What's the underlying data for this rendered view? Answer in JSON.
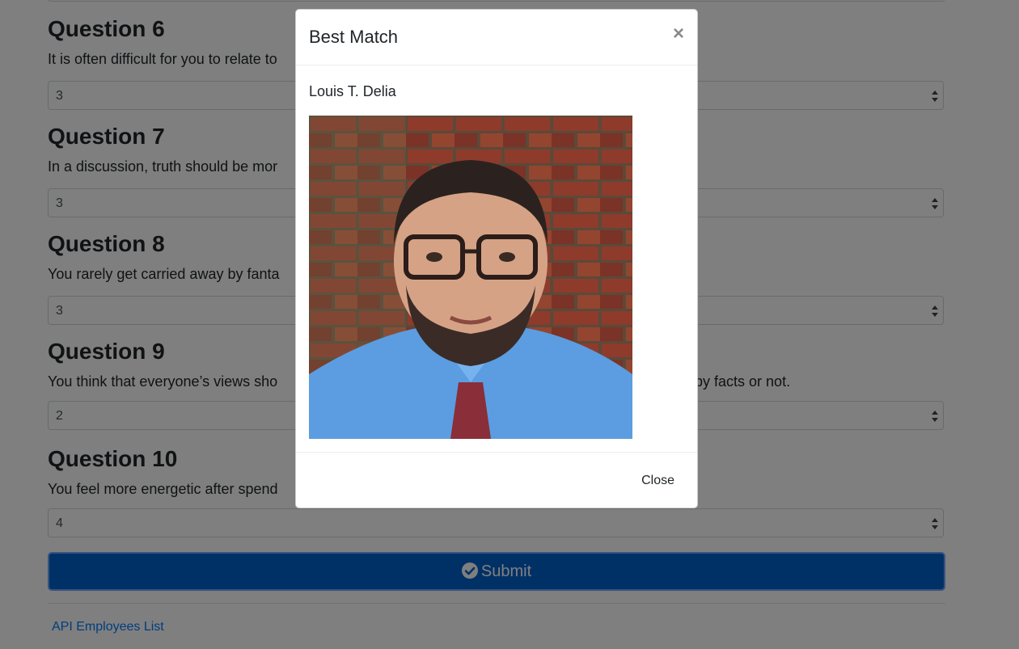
{
  "questions": [
    {
      "title": "Question 6",
      "text": "It is often difficult for you to relate to",
      "value": "3"
    },
    {
      "title": "Question 7",
      "text": "In a discussion, truth should be mor",
      "value": "3"
    },
    {
      "title": "Question 8",
      "text": "You rarely get carried away by fanta",
      "value": "3"
    },
    {
      "title": "Question 9",
      "text": "You think that everyone’s views sho",
      "text_tail": "d by facts or not.",
      "value": "2"
    },
    {
      "title": "Question 10",
      "text": "You feel more energetic after spend",
      "value": "4"
    }
  ],
  "submit": {
    "label": "Submit",
    "icon": "check-circle-icon"
  },
  "footer_link": "API Employees List",
  "modal": {
    "title": "Best Match",
    "close_symbol": "×",
    "match_name": "Louis T. Delia",
    "close_button": "Close"
  },
  "colors": {
    "primary": "#0062cc",
    "link": "#007bff",
    "backdrop": "rgba(0,0,0,0.5)"
  }
}
